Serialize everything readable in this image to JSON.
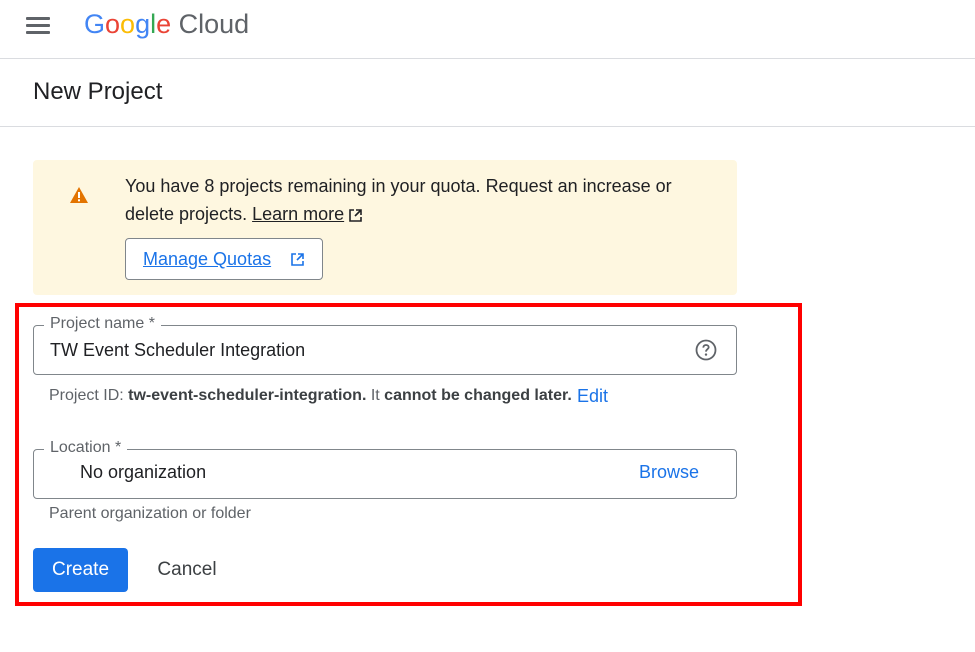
{
  "header": {
    "menu_icon": "hamburger-menu-icon",
    "logo_letters": [
      "G",
      "o",
      "o",
      "g",
      "l",
      "e"
    ],
    "logo_suffix": "Cloud"
  },
  "page": {
    "title": "New Project"
  },
  "quota_banner": {
    "icon": "warning-icon",
    "message": "You have 8 projects remaining in your quota. Request an increase or delete projects.",
    "learn_more_label": "Learn more",
    "manage_quotas_label": "Manage Quotas",
    "external_link_icon": "open-in-new-icon",
    "background_color": "#fef7e0",
    "icon_color": "#e37400"
  },
  "form": {
    "project_name": {
      "label": "Project name *",
      "value": "TW Event Scheduler Integration",
      "help_icon": "help-circle-icon"
    },
    "project_id": {
      "prefix": "Project ID: ",
      "value": "tw-event-scheduler-integration.",
      "middle": " It ",
      "emphasis": "cannot be changed later.",
      "edit_label": "Edit"
    },
    "location": {
      "label": "Location *",
      "value": "No organization",
      "browse_label": "Browse",
      "helper_text": "Parent organization or folder"
    },
    "create_label": "Create",
    "cancel_label": "Cancel"
  },
  "colors": {
    "accent": "#1a73e8",
    "highlight_border": "#ff0000"
  }
}
